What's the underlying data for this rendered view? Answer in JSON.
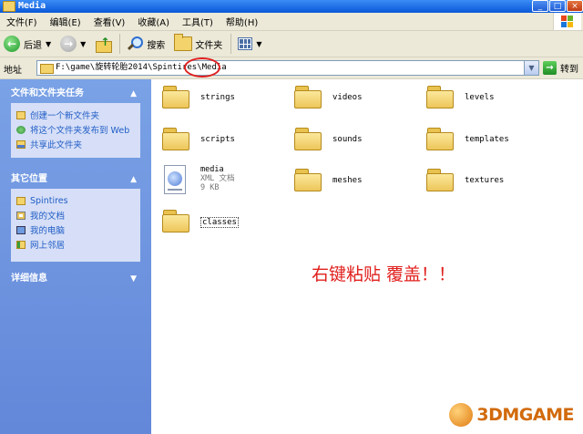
{
  "window": {
    "title": "Media",
    "buttons": {
      "minimize": "_",
      "maximize": "□",
      "close": "×"
    }
  },
  "menu": [
    "文件(F)",
    "编辑(E)",
    "查看(V)",
    "收藏(A)",
    "工具(T)",
    "帮助(H)"
  ],
  "toolbar": {
    "back_label": "后退",
    "search_label": "搜索",
    "folders_label": "文件夹"
  },
  "address": {
    "label": "地址",
    "path": "F:\\game\\旋转轮胎2014\\Spintires\\Media",
    "go_label": "转到"
  },
  "sidebar": {
    "tasks": {
      "title": "文件和文件夹任务",
      "items": [
        "创建一个新文件夹",
        "将这个文件夹发布到 Web",
        "共享此文件夹"
      ]
    },
    "other_places": {
      "title": "其它位置",
      "items": [
        "Spintires",
        "我的文档",
        "我的电脑",
        "网上邻居"
      ]
    },
    "details": {
      "title": "详细信息"
    }
  },
  "content": {
    "items": [
      {
        "name": "strings",
        "type": "folder"
      },
      {
        "name": "videos",
        "type": "folder"
      },
      {
        "name": "levels",
        "type": "folder"
      },
      {
        "name": "scripts",
        "type": "folder"
      },
      {
        "name": "sounds",
        "type": "folder"
      },
      {
        "name": "templates",
        "type": "folder"
      },
      {
        "name": "media",
        "type": "xml",
        "subtitle": "XML 文档",
        "size": "9 KB"
      },
      {
        "name": "meshes",
        "type": "folder"
      },
      {
        "name": "textures",
        "type": "folder"
      },
      {
        "name": "classes",
        "type": "folder"
      }
    ],
    "annotation": "右键粘贴 覆盖！！"
  },
  "watermark": "3DMGAME",
  "colors": {
    "sidebar": "#6f95e0",
    "title_bar": "#0a58d8",
    "annotation": "#e0201d"
  }
}
